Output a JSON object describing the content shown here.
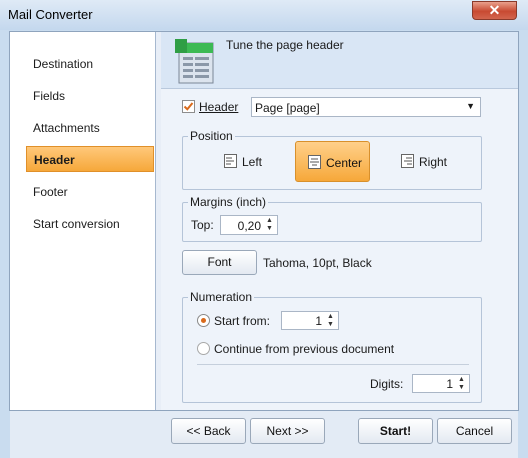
{
  "window": {
    "title": "Mail Converter",
    "close_glyph": "✕"
  },
  "sidebar": {
    "items": [
      {
        "label": "Destination"
      },
      {
        "label": "Fields"
      },
      {
        "label": "Attachments"
      },
      {
        "label": "Header",
        "active": true
      },
      {
        "label": "Footer"
      },
      {
        "label": "Start conversion"
      }
    ]
  },
  "banner": {
    "title": "Tune the page header",
    "icon": "document-header-icon"
  },
  "header_option": {
    "checkbox_label": "Header",
    "checked": true,
    "value": "Page [page]"
  },
  "position": {
    "title": "Position",
    "left_label": "Left",
    "center_label": "Center",
    "right_label": "Right",
    "selected": "Center"
  },
  "margins": {
    "title": "Margins (inch)",
    "top_label": "Top:",
    "top_value": "0,20"
  },
  "font": {
    "button_label": "Font",
    "description": "Tahoma, 10pt, Black"
  },
  "numeration": {
    "title": "Numeration",
    "start_from_label": "Start from:",
    "start_from_value": "1",
    "continue_label": "Continue from previous document",
    "selected": "start_from",
    "digits_label": "Digits:",
    "digits_value": "1"
  },
  "buttons": {
    "back": "<< Back",
    "next": "Next >>",
    "start": "Start!",
    "cancel": "Cancel"
  },
  "colors": {
    "accent": "#f6a83a",
    "close": "#c84a32",
    "checkbox": "#d96a1c"
  }
}
